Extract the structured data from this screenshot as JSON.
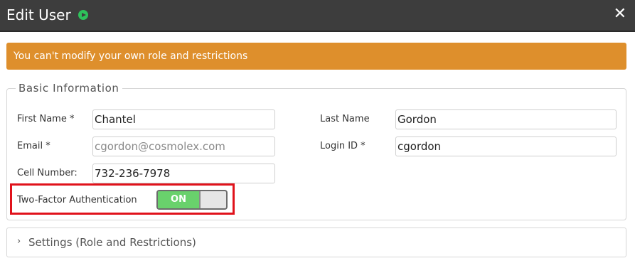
{
  "dialog": {
    "title": "Edit User",
    "close_icon": "close-icon",
    "play_icon": "play-icon"
  },
  "alert": {
    "text": "You can't modify your own role and restrictions",
    "color": "#de8f2c"
  },
  "basic_info": {
    "legend": "Basic Information",
    "first_name_label": "First Name *",
    "first_name_value": "Chantel",
    "last_name_label": "Last Name",
    "last_name_value": "Gordon",
    "email_label": "Email *",
    "email_value": "cgordon@cosmolex.com",
    "login_id_label": "Login ID *",
    "login_id_value": "cgordon",
    "cell_label": "Cell Number:",
    "cell_value": "732-236-7978",
    "two_factor_label": "Two-Factor Authentication",
    "two_factor_state": "ON",
    "toggle_color": "#69d16c",
    "highlight_color": "#e0121b"
  },
  "settings": {
    "label": "Settings (Role and Restrictions)",
    "icon": "chevron-right-icon"
  }
}
